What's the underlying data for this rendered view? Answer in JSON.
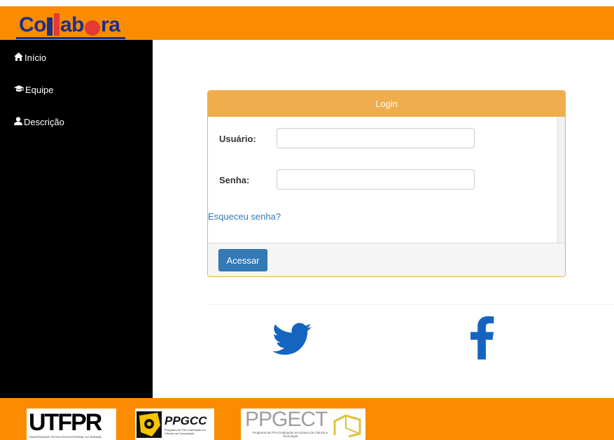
{
  "header": {
    "logo_text": "Collabora",
    "colors": {
      "bar": "#fb8c00",
      "logo_blue": "#1a2f8c",
      "logo_red": "#e53935"
    }
  },
  "sidebar": {
    "items": [
      {
        "label": "Início",
        "icon": "home-icon"
      },
      {
        "label": "Equipe",
        "icon": "graduation-cap-icon"
      },
      {
        "label": "Descrição",
        "icon": "user-icon"
      }
    ]
  },
  "login": {
    "title": "Login",
    "username_label": "Usuário:",
    "username_value": "",
    "password_label": "Senha:",
    "password_value": "",
    "forgot_link": "Esqueceu senha?",
    "submit_label": "Acessar",
    "colors": {
      "heading": "#f0ad4e",
      "button": "#337ab7",
      "link": "#337ab7"
    }
  },
  "social": {
    "items": [
      {
        "icon": "twitter-icon",
        "color": "#1565c0"
      },
      {
        "icon": "facebook-icon",
        "color": "#1565c0"
      }
    ]
  },
  "footer": {
    "sponsors": [
      {
        "name": "UTFPR",
        "caption": "UNIVERSIDADE TECNOLÓGICA FEDERAL DO PARANÁ"
      },
      {
        "name": "PPGCC",
        "caption": "Programa de Pós-Graduação em Ciência da Computação"
      },
      {
        "name": "PPGECT",
        "caption": "Programa de Pós-Graduação em Ensino de Ciência e Tecnologia"
      }
    ]
  }
}
